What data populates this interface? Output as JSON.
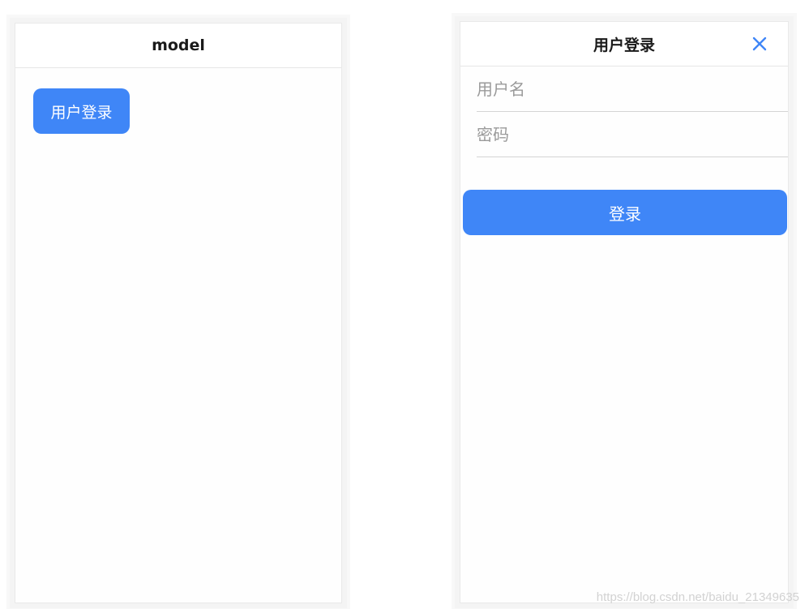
{
  "left_screen": {
    "title": "model",
    "open_button_label": "用户登录"
  },
  "right_screen": {
    "title": "用户登录",
    "close_icon": "close-icon",
    "username": {
      "value": "",
      "placeholder": "用户名"
    },
    "password": {
      "value": "",
      "placeholder": "密码"
    },
    "login_button_label": "登录"
  },
  "watermark": "https://blog.csdn.net/baidu_21349635",
  "colors": {
    "primary": "#3f86f7",
    "title": "#1a1a1a",
    "placeholder": "#9a9a9a",
    "divider": "#d4d4d4"
  }
}
